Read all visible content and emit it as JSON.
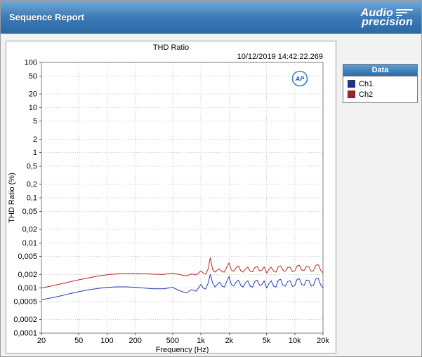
{
  "header": {
    "title": "Sequence Report",
    "logo_line1": "Audio",
    "logo_line2": "precision"
  },
  "report": {
    "chart_title": "THD Ratio",
    "timestamp": "10/12/2019 14:42:22.269",
    "ap_badge": "AP"
  },
  "legend": {
    "title": "Data",
    "entries": [
      {
        "label": "Ch1",
        "color": "#1b2f9e"
      },
      {
        "label": "Ch2",
        "color": "#b01f1f"
      }
    ]
  },
  "chart_data": {
    "type": "line",
    "title": "THD Ratio",
    "xlabel": "Frequency (Hz)",
    "ylabel": "THD Ratio (%)",
    "x_scale": "log",
    "y_scale": "log",
    "xlim": [
      20,
      20000
    ],
    "ylim": [
      0.0001,
      100
    ],
    "grid": true,
    "legend_position": "right",
    "xticks": [
      [
        20,
        "20"
      ],
      [
        50,
        "50"
      ],
      [
        100,
        "100"
      ],
      [
        200,
        "200"
      ],
      [
        500,
        "500"
      ],
      [
        1000,
        "1k"
      ],
      [
        2000,
        "2k"
      ],
      [
        5000,
        "5k"
      ],
      [
        10000,
        "10k"
      ],
      [
        20000,
        "20k"
      ]
    ],
    "yticks": [
      [
        100,
        "100"
      ],
      [
        50,
        "50"
      ],
      [
        20,
        "20"
      ],
      [
        10,
        "10"
      ],
      [
        5,
        "5"
      ],
      [
        2,
        "2"
      ],
      [
        1,
        "1"
      ],
      [
        0.5,
        "0,5"
      ],
      [
        0.2,
        "0,2"
      ],
      [
        0.1,
        "0,1"
      ],
      [
        0.05,
        "0,05"
      ],
      [
        0.02,
        "0,02"
      ],
      [
        0.01,
        "0,01"
      ],
      [
        0.005,
        "0,005"
      ],
      [
        0.002,
        "0,002"
      ],
      [
        0.001,
        "0,001"
      ],
      [
        0.0005,
        "0,0005"
      ],
      [
        0.0002,
        "0,0002"
      ],
      [
        0.0001,
        "0,0001"
      ]
    ],
    "series": [
      {
        "name": "Ch1",
        "color": "#2438b8",
        "points": [
          [
            20,
            0.00055
          ],
          [
            25,
            0.0006
          ],
          [
            32,
            0.00067
          ],
          [
            40,
            0.00075
          ],
          [
            50,
            0.00083
          ],
          [
            63,
            0.00091
          ],
          [
            80,
            0.00098
          ],
          [
            100,
            0.00103
          ],
          [
            126,
            0.00106
          ],
          [
            159,
            0.00106
          ],
          [
            200,
            0.00104
          ],
          [
            251,
            0.001
          ],
          [
            316,
            0.00096
          ],
          [
            398,
            0.00096
          ],
          [
            501,
            0.00103
          ],
          [
            562,
            0.00092
          ],
          [
            631,
            0.00083
          ],
          [
            708,
            0.00078
          ],
          [
            794,
            0.00092
          ],
          [
            891,
            0.00085
          ],
          [
            1000,
            0.0012
          ],
          [
            1059,
            0.001
          ],
          [
            1122,
            0.00095
          ],
          [
            1189,
            0.00125
          ],
          [
            1259,
            0.002
          ],
          [
            1334,
            0.0013
          ],
          [
            1413,
            0.00105
          ],
          [
            1496,
            0.0012
          ],
          [
            1585,
            0.00135
          ],
          [
            1679,
            0.0011
          ],
          [
            1778,
            0.00105
          ],
          [
            1884,
            0.0014
          ],
          [
            1995,
            0.0018
          ],
          [
            2113,
            0.0012
          ],
          [
            2239,
            0.0011
          ],
          [
            2371,
            0.00135
          ],
          [
            2512,
            0.0015
          ],
          [
            2661,
            0.00115
          ],
          [
            2818,
            0.00105
          ],
          [
            2985,
            0.0013
          ],
          [
            3162,
            0.00145
          ],
          [
            3350,
            0.0011
          ],
          [
            3548,
            0.00105
          ],
          [
            3758,
            0.0014
          ],
          [
            3981,
            0.0015
          ],
          [
            4217,
            0.00115
          ],
          [
            4467,
            0.0012
          ],
          [
            4732,
            0.00145
          ],
          [
            5012,
            0.001
          ],
          [
            5309,
            0.00125
          ],
          [
            5623,
            0.00145
          ],
          [
            5957,
            0.0011
          ],
          [
            6310,
            0.00105
          ],
          [
            6683,
            0.0015
          ],
          [
            7079,
            0.00155
          ],
          [
            7499,
            0.00115
          ],
          [
            7943,
            0.0011
          ],
          [
            8414,
            0.0014
          ],
          [
            8913,
            0.00145
          ],
          [
            9441,
            0.00108
          ],
          [
            10000,
            0.00115
          ],
          [
            10593,
            0.00155
          ],
          [
            11220,
            0.0016
          ],
          [
            11885,
            0.0012
          ],
          [
            12590,
            0.00115
          ],
          [
            13335,
            0.0015
          ],
          [
            14130,
            0.00148
          ],
          [
            14962,
            0.0011
          ],
          [
            15850,
            0.00115
          ],
          [
            16788,
            0.0016
          ],
          [
            17780,
            0.00165
          ],
          [
            18836,
            0.0012
          ],
          [
            20000,
            0.001
          ]
        ]
      },
      {
        "name": "Ch2",
        "color": "#bb2424",
        "points": [
          [
            20,
            0.001
          ],
          [
            25,
            0.0011
          ],
          [
            32,
            0.00123
          ],
          [
            40,
            0.00137
          ],
          [
            50,
            0.00152
          ],
          [
            63,
            0.00168
          ],
          [
            80,
            0.00184
          ],
          [
            100,
            0.00197
          ],
          [
            126,
            0.00206
          ],
          [
            159,
            0.00211
          ],
          [
            200,
            0.00212
          ],
          [
            251,
            0.00208
          ],
          [
            316,
            0.00202
          ],
          [
            398,
            0.00199
          ],
          [
            501,
            0.00215
          ],
          [
            562,
            0.00204
          ],
          [
            631,
            0.00194
          ],
          [
            708,
            0.00186
          ],
          [
            794,
            0.00206
          ],
          [
            891,
            0.00195
          ],
          [
            1000,
            0.0024
          ],
          [
            1059,
            0.00215
          ],
          [
            1122,
            0.00205
          ],
          [
            1189,
            0.00255
          ],
          [
            1259,
            0.0047
          ],
          [
            1334,
            0.0026
          ],
          [
            1413,
            0.00225
          ],
          [
            1496,
            0.0025
          ],
          [
            1585,
            0.00265
          ],
          [
            1679,
            0.0023
          ],
          [
            1778,
            0.00225
          ],
          [
            1884,
            0.0029
          ],
          [
            1995,
            0.0036
          ],
          [
            2113,
            0.0025
          ],
          [
            2239,
            0.00235
          ],
          [
            2371,
            0.0028
          ],
          [
            2512,
            0.0031
          ],
          [
            2661,
            0.0024
          ],
          [
            2818,
            0.00225
          ],
          [
            2985,
            0.00265
          ],
          [
            3162,
            0.0029
          ],
          [
            3350,
            0.00235
          ],
          [
            3548,
            0.0023
          ],
          [
            3758,
            0.00285
          ],
          [
            3981,
            0.003
          ],
          [
            4217,
            0.0024
          ],
          [
            4467,
            0.0025
          ],
          [
            4732,
            0.00295
          ],
          [
            5012,
            0.00215
          ],
          [
            5309,
            0.0026
          ],
          [
            5623,
            0.0029
          ],
          [
            5957,
            0.00235
          ],
          [
            6310,
            0.00225
          ],
          [
            6683,
            0.003
          ],
          [
            7079,
            0.0031
          ],
          [
            7499,
            0.00245
          ],
          [
            7943,
            0.00235
          ],
          [
            8414,
            0.00285
          ],
          [
            8913,
            0.0029
          ],
          [
            9441,
            0.0023
          ],
          [
            10000,
            0.0024
          ],
          [
            10593,
            0.0031
          ],
          [
            11220,
            0.0032
          ],
          [
            11885,
            0.0025
          ],
          [
            12590,
            0.00245
          ],
          [
            13335,
            0.003
          ],
          [
            14130,
            0.00295
          ],
          [
            14962,
            0.00235
          ],
          [
            15850,
            0.0024
          ],
          [
            16788,
            0.0032
          ],
          [
            17780,
            0.0033
          ],
          [
            18836,
            0.0025
          ],
          [
            20000,
            0.00215
          ]
        ]
      }
    ]
  }
}
